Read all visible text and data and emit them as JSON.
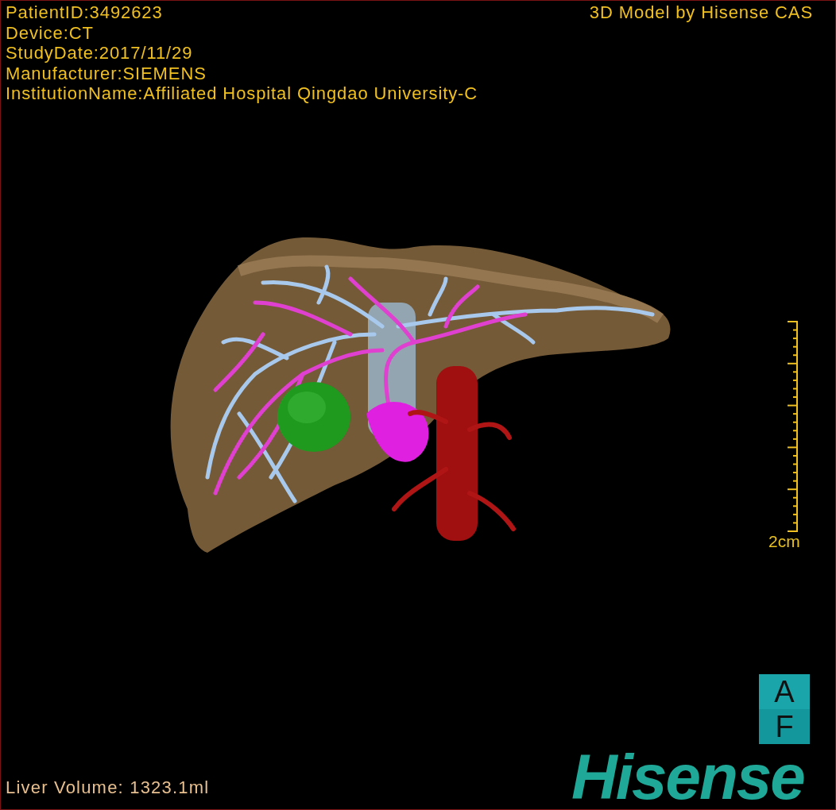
{
  "viewport": {
    "patient_info": [
      "PatientID:3492623",
      "Device:CT",
      "StudyDate:2017/11/29",
      "Manufacturer:SIEMENS",
      "InstitutionName:Affiliated Hospital Qingdao University-C"
    ],
    "credit": "3D Model by Hisense CAS",
    "scale_bar": {
      "label": "2cm"
    },
    "orientation_cube": {
      "top_label": "A",
      "front_label": "F"
    },
    "logo": "Hisense",
    "measurement": "Liver Volume: 1323.1ml"
  }
}
